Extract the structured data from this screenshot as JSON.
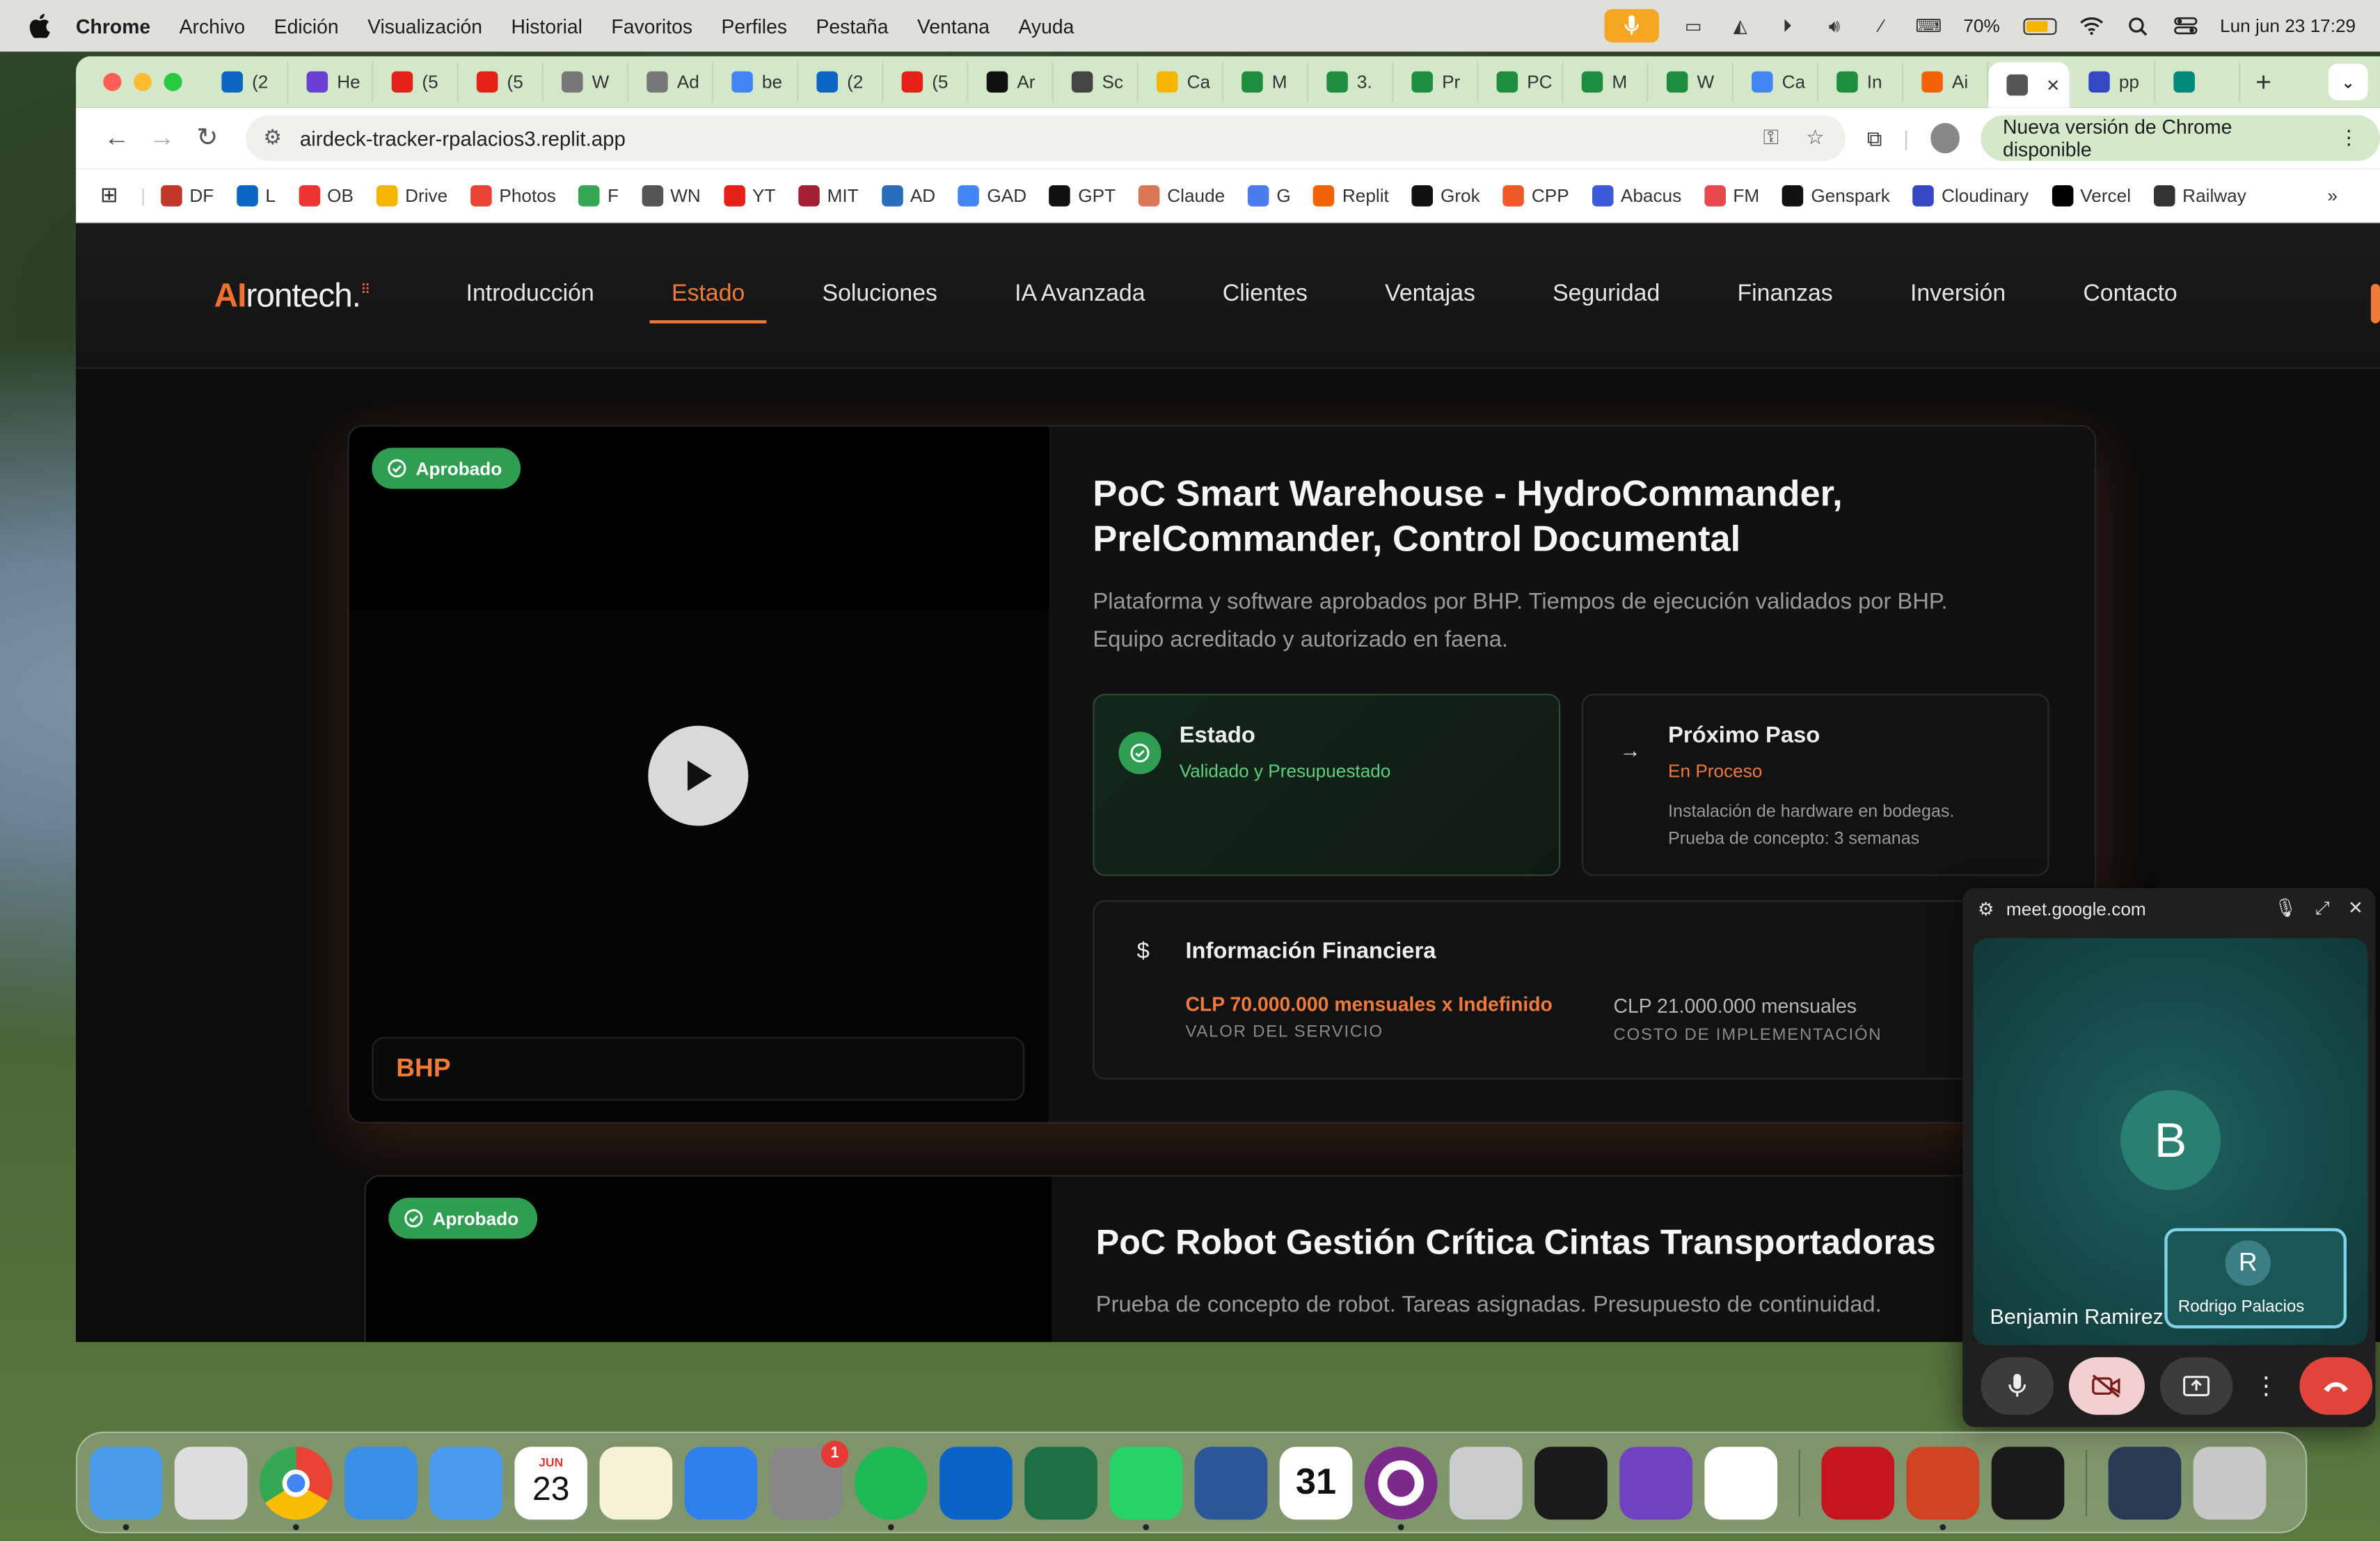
{
  "menubar": {
    "app": "Chrome",
    "items": [
      "Archivo",
      "Edición",
      "Visualización",
      "Historial",
      "Favoritos",
      "Perfiles",
      "Pestaña",
      "Ventana",
      "Ayuda"
    ],
    "battery": "70%",
    "datetime": "Lun jun 23  17:29"
  },
  "tabs": [
    {
      "label": "(2",
      "icon": "linkedin-icon",
      "color": "#0a66c2"
    },
    {
      "label": "He",
      "icon": "play-circle-icon",
      "color": "#6b3fd4"
    },
    {
      "label": "(5",
      "icon": "youtube-icon",
      "color": "#e62117"
    },
    {
      "label": "(5",
      "icon": "youtube-icon",
      "color": "#e62117"
    },
    {
      "label": "W",
      "icon": "globe-icon",
      "color": "#777"
    },
    {
      "label": "Ad",
      "icon": "globe-icon",
      "color": "#777"
    },
    {
      "label": "be",
      "icon": "google-icon",
      "color": "#4285f4"
    },
    {
      "label": "(2",
      "icon": "linkedin-icon",
      "color": "#0a66c2"
    },
    {
      "label": "(5",
      "icon": "youtube-icon",
      "color": "#e62117"
    },
    {
      "label": "Ar",
      "icon": "openai-icon",
      "color": "#111"
    },
    {
      "label": "Sc",
      "icon": "openai-icon",
      "color": "#444"
    },
    {
      "label": "Ca",
      "icon": "drive-icon",
      "color": "#f4b400"
    },
    {
      "label": "M",
      "icon": "sheets-icon",
      "color": "#1e8e3e"
    },
    {
      "label": "3.",
      "icon": "sheets-icon",
      "color": "#1e8e3e"
    },
    {
      "label": "Pr",
      "icon": "sheets-icon",
      "color": "#1e8e3e"
    },
    {
      "label": "PC",
      "icon": "sheets-icon",
      "color": "#1e8e3e"
    },
    {
      "label": "M",
      "icon": "sheets-icon",
      "color": "#1e8e3e"
    },
    {
      "label": "W",
      "icon": "sheets-icon",
      "color": "#1e8e3e"
    },
    {
      "label": "Ca",
      "icon": "docs-icon",
      "color": "#4285f4"
    },
    {
      "label": "In",
      "icon": "sheets-icon",
      "color": "#1e8e3e"
    },
    {
      "label": "Ai",
      "icon": "replit-icon",
      "color": "#f26207"
    },
    {
      "label": "",
      "icon": "globe-icon",
      "color": "#555",
      "active": true
    },
    {
      "label": "pp",
      "icon": "cloudinary-icon",
      "color": "#3448c5"
    },
    {
      "label": "",
      "icon": "meet-icon",
      "color": "#00897b"
    }
  ],
  "toolbar": {
    "url": "airdeck-tracker-rpalacios3.replit.app",
    "update": "Nueva versión de Chrome disponible"
  },
  "bookmarks": [
    {
      "label": "DF",
      "color": "#c0392b"
    },
    {
      "label": "L",
      "color": "#0a66c2"
    },
    {
      "label": "OB",
      "color": "#e33"
    },
    {
      "label": "Drive",
      "color": "#f4b400"
    },
    {
      "label": "Photos",
      "color": "#ea4335"
    },
    {
      "label": "F",
      "color": "#34a853"
    },
    {
      "label": "WN",
      "color": "#555"
    },
    {
      "label": "YT",
      "color": "#e62117"
    },
    {
      "label": "MIT",
      "color": "#a31f34"
    },
    {
      "label": "AD",
      "color": "#2a6ebb"
    },
    {
      "label": "GAD",
      "color": "#4285f4"
    },
    {
      "label": "GPT",
      "color": "#111"
    },
    {
      "label": "Claude",
      "color": "#d97757"
    },
    {
      "label": "G",
      "color": "#4a7cf0"
    },
    {
      "label": "Replit",
      "color": "#f26207"
    },
    {
      "label": "Grok",
      "color": "#111"
    },
    {
      "label": "CPP",
      "color": "#f05a28"
    },
    {
      "label": "Abacus",
      "color": "#3b5bdb"
    },
    {
      "label": "FM",
      "color": "#e5484d"
    },
    {
      "label": "Genspark",
      "color": "#111"
    },
    {
      "label": "Cloudinary",
      "color": "#3448c5"
    },
    {
      "label": "Vercel",
      "color": "#000"
    },
    {
      "label": "Railway",
      "color": "#333"
    }
  ],
  "site": {
    "logo_main": "AI",
    "logo_rest": "rontech.",
    "nav": [
      "Introducción",
      "Estado",
      "Soluciones",
      "IA Avanzada",
      "Clientes",
      "Ventajas",
      "Seguridad",
      "Finanzas",
      "Inversión",
      "Contacto"
    ],
    "active_nav": "Estado",
    "accent": "#f07a3a",
    "card1": {
      "badge": "Aprobado",
      "client": "BHP",
      "title": "PoC Smart Warehouse - HydroCommander, PrelCommander, Control Documental",
      "description": "Plataforma y software aprobados por BHP. Tiempos de ejecución validados por BHP. Equipo acreditado y autorizado en faena.",
      "status_title": "Estado",
      "status_value": "Validado y Presupuestado",
      "next_title": "Próximo Paso",
      "next_value": "En Proceso",
      "next_note1": "Instalación de hardware en bodegas.",
      "next_note2": "Prueba de concepto: 3 semanas",
      "fin_title": "Información Financiera",
      "service_value": "CLP 70.000.000 mensuales x Indefinido",
      "service_label": "VALOR DEL SERVICIO",
      "impl_value": "CLP 21.000.000 mensuales",
      "impl_label": "COSTO DE IMPLEMENTACIÓN"
    },
    "card2": {
      "badge": "Aprobado",
      "title": "PoC Robot Gestión Crítica Cintas Transportadoras",
      "description": "Prueba de concepto de robot. Tareas asignadas. Presupuesto de continuidad."
    }
  },
  "meet": {
    "host": "meet.google.com",
    "participant_initial": "B",
    "participant_name": "Benjamin Ramirez",
    "self_initial": "R",
    "self_name": "Rodrigo Palacios"
  },
  "dock": [
    {
      "name": "finder",
      "color": "#4a9be8"
    },
    {
      "name": "launchpad",
      "color": "#ddd"
    },
    {
      "name": "chrome",
      "color": "#fff"
    },
    {
      "name": "safari",
      "color": "#3a8ee6"
    },
    {
      "name": "mail",
      "color": "#4b9cf0"
    },
    {
      "name": "calendar",
      "color": "#fff",
      "month": "JUN",
      "day": "23"
    },
    {
      "name": "notes",
      "color": "#f7f1d8"
    },
    {
      "name": "keynote",
      "color": "#2f80ed"
    },
    {
      "name": "system-settings",
      "color": "#888",
      "badge": "1"
    },
    {
      "name": "spotify",
      "color": "#1db954"
    },
    {
      "name": "outlook",
      "color": "#0a64c8"
    },
    {
      "name": "excel",
      "color": "#1d7044"
    },
    {
      "name": "whatsapp",
      "color": "#25d366"
    },
    {
      "name": "word",
      "color": "#2b579a"
    },
    {
      "name": "calendar-31",
      "color": "#fff",
      "day": "31"
    },
    {
      "name": "circle-app",
      "color": "#7b2a8a"
    },
    {
      "name": "iphone-mirroring",
      "color": "#ccc"
    },
    {
      "name": "replit",
      "color": "#1a1a1a"
    },
    {
      "name": "github-desktop",
      "color": "#6f42c1"
    },
    {
      "name": "vscode",
      "color": "#fff"
    },
    {
      "name": "acrobat",
      "color": "#c4161c"
    },
    {
      "name": "powerpoint",
      "color": "#d04423"
    },
    {
      "name": "quicktime",
      "color": "#1a1a1a"
    },
    {
      "name": "downloads",
      "color": "#2a3a55"
    },
    {
      "name": "trash",
      "color": "#c8c8c8"
    }
  ]
}
